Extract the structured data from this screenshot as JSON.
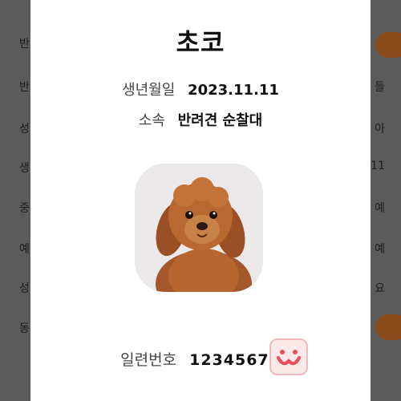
{
  "background": {
    "rows_left": [
      "반",
      "반",
      "성",
      "생",
      "중",
      "예",
      "성",
      "동"
    ],
    "rows_right": [
      "",
      "들",
      "아",
      "11",
      "예",
      "예",
      "요",
      ""
    ]
  },
  "dog": {
    "name": "초코",
    "birth_label": "생년월일",
    "birth_value": "2023.11.11",
    "affiliation_label": "소속",
    "affiliation_value": "반려견 순찰대",
    "registration_label": "일련번호",
    "registration_value": "12345678"
  },
  "icons": {
    "photo": "dog-photo",
    "badge": "smile-badge-icon"
  },
  "colors": {
    "accent_brown": "#8a4a1a",
    "badge_pink": "#e94b57"
  }
}
